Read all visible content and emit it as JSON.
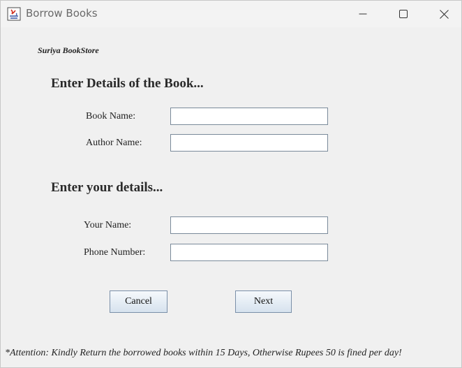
{
  "window": {
    "title": "Borrow Books",
    "icon": "java-app-icon"
  },
  "store_name": "Suriya BookStore",
  "book_section": {
    "heading": "Enter Details of the Book...",
    "book_name_label": "Book Name:",
    "book_name_value": "",
    "author_name_label": "Author Name:",
    "author_name_value": ""
  },
  "user_section": {
    "heading": "Enter your details...",
    "your_name_label": "Your Name:",
    "your_name_value": "",
    "phone_label": "Phone Number:",
    "phone_value": ""
  },
  "buttons": {
    "cancel": "Cancel",
    "next": "Next"
  },
  "attention": "*Attention: Kindly Return the borrowed books within 15 Days, Otherwise Rupees 50 is fined per day!"
}
